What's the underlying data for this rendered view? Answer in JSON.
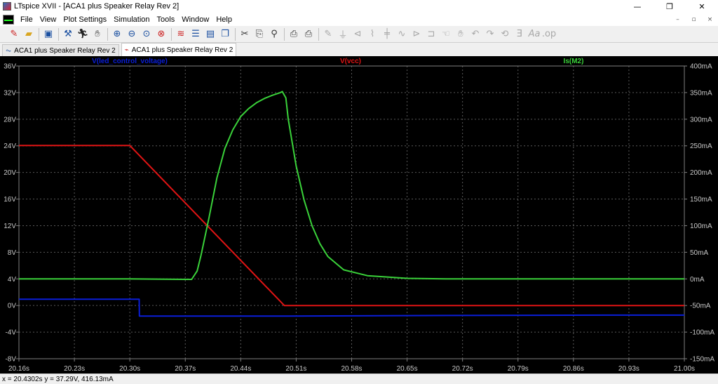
{
  "window": {
    "title": "LTspice XVII - [ACA1 plus Speaker Relay Rev 2]",
    "minimize": "—",
    "maximize": "❐",
    "close": "✕"
  },
  "menu": {
    "items": [
      "File",
      "View",
      "Plot Settings",
      "Simulation",
      "Tools",
      "Window",
      "Help"
    ],
    "mdi_minimize": "–",
    "mdi_restore": "▫",
    "mdi_close": "×"
  },
  "toolbar": {
    "icons": [
      "new-schematic-icon",
      "open-icon",
      "save-icon",
      "control-panel-icon",
      "run-icon",
      "halt-icon",
      "zoom-in-icon",
      "zoom-out-icon",
      "zoom-area-icon",
      "zoom-fit-icon",
      "autorange-icon",
      "tile-horizontal-icon",
      "tile-vertical-icon",
      "cascade-icon",
      "cut-icon",
      "copy-icon",
      "find-icon",
      "print-icon",
      "print-preview-icon",
      "wire-icon",
      "ground-icon",
      "label-icon",
      "resistor-icon",
      "capacitor-icon",
      "inductor-icon",
      "diode-icon",
      "component-icon",
      "move-icon",
      "drag-icon",
      "undo-icon",
      "redo-icon",
      "rotate-icon",
      "mirror-icon",
      "text-icon",
      "spice-directive-icon"
    ]
  },
  "tabs": [
    {
      "label": "ACA1 plus Speaker Relay Rev 2",
      "icon": "schematic-icon",
      "active": false
    },
    {
      "label": "ACA1 plus Speaker Relay Rev 2",
      "icon": "waveform-icon",
      "active": true
    }
  ],
  "status": {
    "text": "x = 20.4302s   y = 37.29V, 416.13mA"
  },
  "chart_data": {
    "type": "line",
    "x_ticks": [
      "20.16s",
      "20.23s",
      "20.30s",
      "20.37s",
      "20.44s",
      "20.51s",
      "20.58s",
      "20.65s",
      "20.72s",
      "20.79s",
      "20.86s",
      "20.93s",
      "21.00s"
    ],
    "y_left_ticks": [
      "36V",
      "32V",
      "28V",
      "24V",
      "20V",
      "16V",
      "12V",
      "8V",
      "4V",
      "0V",
      "-4V",
      "-8V"
    ],
    "y_right_ticks": [
      "400mA",
      "350mA",
      "300mA",
      "250mA",
      "200mA",
      "150mA",
      "100mA",
      "50mA",
      "0mA",
      "-50mA",
      "-100mA",
      "-150mA"
    ],
    "xlim": [
      20.16,
      21.0
    ],
    "ylim_left": [
      -8,
      36
    ],
    "ylim_right": [
      -150,
      400
    ],
    "grid": true,
    "colors": {
      "background": "#000000",
      "grid": "#5a5a5a",
      "axis": "#808080",
      "ticks": "#c8c8c8"
    },
    "series": [
      {
        "name": "V(led_control_voltage)",
        "color": "#0a1ed8",
        "axis": "left",
        "x": [
          20.16,
          20.3118,
          20.3121,
          20.5,
          20.7,
          20.9,
          21.0
        ],
        "y": [
          0.95,
          0.95,
          -1.6,
          -1.6,
          -1.5,
          -1.45,
          -1.45
        ]
      },
      {
        "name": "V(vcc)",
        "color": "#e01414",
        "axis": "left",
        "x": [
          20.16,
          20.3,
          20.495,
          21.0
        ],
        "y": [
          24.05,
          24.05,
          0.0,
          0.0
        ]
      },
      {
        "name": "Is(M2)",
        "color": "#3ad23a",
        "axis": "right",
        "x": [
          20.16,
          20.3,
          20.378,
          20.385,
          20.39,
          20.4,
          20.41,
          20.42,
          20.43,
          20.44,
          20.45,
          20.46,
          20.47,
          20.48,
          20.49,
          20.4925,
          20.497,
          20.5,
          20.51,
          20.52,
          20.53,
          20.54,
          20.55,
          20.57,
          20.6,
          20.65,
          20.7,
          21.0
        ],
        "y": [
          0,
          0,
          -1,
          15,
          45,
          115,
          190,
          245,
          280,
          305,
          320,
          331,
          339,
          345,
          350,
          352,
          340,
          300,
          212,
          148,
          100,
          66,
          42,
          17,
          6,
          1,
          0,
          0
        ]
      }
    ]
  }
}
